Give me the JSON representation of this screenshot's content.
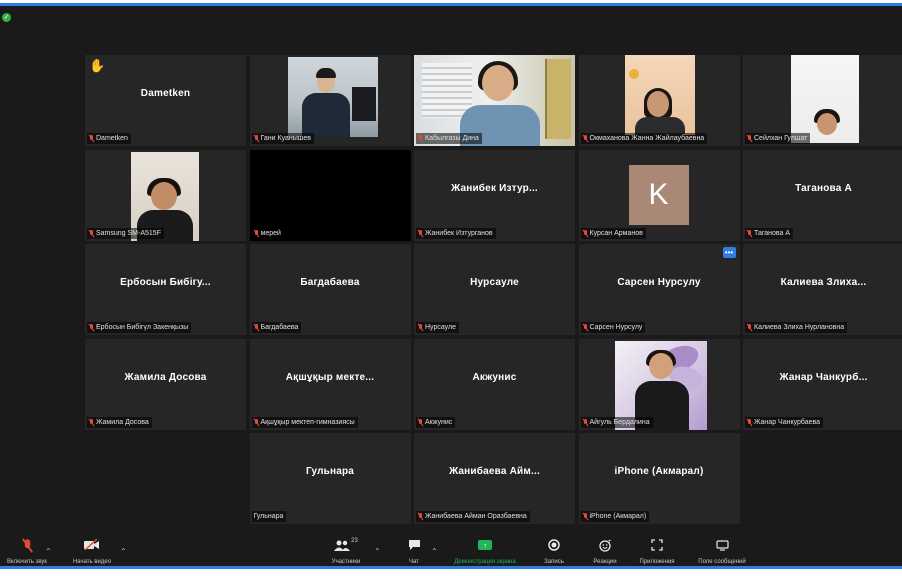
{
  "colors": {
    "frame_border": "#2f7de1",
    "background": "#1a1a1a",
    "tile_background": "#262626",
    "active_speaker": "#cbe33a",
    "muted_mic": "#e14b3b",
    "share_green": "#23b35a",
    "raised_hand": "#f5c342",
    "avatar_k": "#a98877"
  },
  "window": {
    "secure_icon": "shield-check-icon"
  },
  "tiles": [
    {
      "name": "Dametken",
      "label": "Dametken",
      "hand": true
    },
    {
      "name": "",
      "label": "Гани Куанышев",
      "video": "man"
    },
    {
      "name": "",
      "label": "Кабылгазы Дина",
      "video": "woman1",
      "active": true
    },
    {
      "name": "",
      "label": "Окмаханова Жанна Жайлаубаевна",
      "video": "woman2"
    },
    {
      "name": "",
      "label": "Сейлхан Гулшат",
      "video": "woman3"
    },
    {
      "name": "",
      "label": "Samsung SM-A515F",
      "video": "woman4"
    },
    {
      "name": "",
      "label": "мерей",
      "blank": true
    },
    {
      "name": "Жанибек Изтур...",
      "label": "Жанибек Изтурганов"
    },
    {
      "name": "",
      "label": "Курсан Арманов",
      "avatar": "K"
    },
    {
      "name": "Таганова А",
      "label": "Таганова А"
    },
    {
      "name": "Ербосын Бибігу...",
      "label": "Ербосын Бибігүл Закенқызы"
    },
    {
      "name": "Багдабаева",
      "label": "Багдабаева"
    },
    {
      "name": "Нурсауле",
      "label": "Нурсауле"
    },
    {
      "name": "Сарсен Нурсулу",
      "label": "Сарсен Нурсулу",
      "more": true
    },
    {
      "name": "Калиева Злиха...",
      "label": "Калиева Злиха Нурлановна"
    },
    {
      "name": "Жамила Досова",
      "label": "Жамила Досова"
    },
    {
      "name": "Ақшұқыр мекте...",
      "label": "Ақшұқыр мектеп-гимназиясы"
    },
    {
      "name": "Акжунис",
      "label": "Акжунис"
    },
    {
      "name": "",
      "label": "Айгуль Бердалина",
      "video": "woman5"
    },
    {
      "name": "Жанар Чанкурб...",
      "label": "Жанар Чанкурбаева"
    },
    {
      "name": "Гульнара",
      "label": "Гульнара",
      "nomic": true
    },
    {
      "name": "Жанибаева Айм...",
      "label": "Жанибаева Айман Оразбаевна"
    },
    {
      "name": "iPhone (Акмарал)",
      "label": "iPhone (Акмарал)"
    }
  ],
  "toolbar": {
    "unmute": {
      "label": "Включить звук",
      "icon": "mic-muted-icon"
    },
    "video": {
      "label": "Начать видео",
      "icon": "video-off-icon"
    },
    "participants": {
      "label": "Участники",
      "count": "23",
      "icon": "participants-icon"
    },
    "chat": {
      "label": "Чат",
      "icon": "chat-icon"
    },
    "share": {
      "label": "Демонстрация экрана",
      "icon": "share-screen-icon"
    },
    "record": {
      "label": "Запись",
      "icon": "record-icon"
    },
    "reactions": {
      "label": "Реакции",
      "icon": "reactions-icon"
    },
    "apps": {
      "label": "Приложения",
      "icon": "apps-icon"
    },
    "notes": {
      "label": "Поле сообщений",
      "icon": "message-field-icon"
    }
  }
}
